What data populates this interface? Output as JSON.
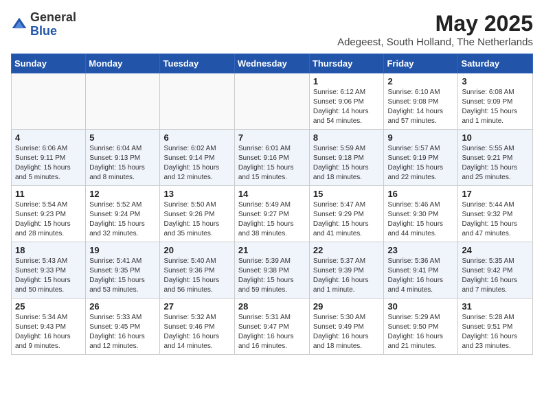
{
  "header": {
    "logo_general": "General",
    "logo_blue": "Blue",
    "month_year": "May 2025",
    "location": "Adegeest, South Holland, The Netherlands"
  },
  "weekdays": [
    "Sunday",
    "Monday",
    "Tuesday",
    "Wednesday",
    "Thursday",
    "Friday",
    "Saturday"
  ],
  "weeks": [
    [
      {
        "day": "",
        "info": ""
      },
      {
        "day": "",
        "info": ""
      },
      {
        "day": "",
        "info": ""
      },
      {
        "day": "",
        "info": ""
      },
      {
        "day": "1",
        "info": "Sunrise: 6:12 AM\nSunset: 9:06 PM\nDaylight: 14 hours\nand 54 minutes."
      },
      {
        "day": "2",
        "info": "Sunrise: 6:10 AM\nSunset: 9:08 PM\nDaylight: 14 hours\nand 57 minutes."
      },
      {
        "day": "3",
        "info": "Sunrise: 6:08 AM\nSunset: 9:09 PM\nDaylight: 15 hours\nand 1 minute."
      }
    ],
    [
      {
        "day": "4",
        "info": "Sunrise: 6:06 AM\nSunset: 9:11 PM\nDaylight: 15 hours\nand 5 minutes."
      },
      {
        "day": "5",
        "info": "Sunrise: 6:04 AM\nSunset: 9:13 PM\nDaylight: 15 hours\nand 8 minutes."
      },
      {
        "day": "6",
        "info": "Sunrise: 6:02 AM\nSunset: 9:14 PM\nDaylight: 15 hours\nand 12 minutes."
      },
      {
        "day": "7",
        "info": "Sunrise: 6:01 AM\nSunset: 9:16 PM\nDaylight: 15 hours\nand 15 minutes."
      },
      {
        "day": "8",
        "info": "Sunrise: 5:59 AM\nSunset: 9:18 PM\nDaylight: 15 hours\nand 18 minutes."
      },
      {
        "day": "9",
        "info": "Sunrise: 5:57 AM\nSunset: 9:19 PM\nDaylight: 15 hours\nand 22 minutes."
      },
      {
        "day": "10",
        "info": "Sunrise: 5:55 AM\nSunset: 9:21 PM\nDaylight: 15 hours\nand 25 minutes."
      }
    ],
    [
      {
        "day": "11",
        "info": "Sunrise: 5:54 AM\nSunset: 9:23 PM\nDaylight: 15 hours\nand 28 minutes."
      },
      {
        "day": "12",
        "info": "Sunrise: 5:52 AM\nSunset: 9:24 PM\nDaylight: 15 hours\nand 32 minutes."
      },
      {
        "day": "13",
        "info": "Sunrise: 5:50 AM\nSunset: 9:26 PM\nDaylight: 15 hours\nand 35 minutes."
      },
      {
        "day": "14",
        "info": "Sunrise: 5:49 AM\nSunset: 9:27 PM\nDaylight: 15 hours\nand 38 minutes."
      },
      {
        "day": "15",
        "info": "Sunrise: 5:47 AM\nSunset: 9:29 PM\nDaylight: 15 hours\nand 41 minutes."
      },
      {
        "day": "16",
        "info": "Sunrise: 5:46 AM\nSunset: 9:30 PM\nDaylight: 15 hours\nand 44 minutes."
      },
      {
        "day": "17",
        "info": "Sunrise: 5:44 AM\nSunset: 9:32 PM\nDaylight: 15 hours\nand 47 minutes."
      }
    ],
    [
      {
        "day": "18",
        "info": "Sunrise: 5:43 AM\nSunset: 9:33 PM\nDaylight: 15 hours\nand 50 minutes."
      },
      {
        "day": "19",
        "info": "Sunrise: 5:41 AM\nSunset: 9:35 PM\nDaylight: 15 hours\nand 53 minutes."
      },
      {
        "day": "20",
        "info": "Sunrise: 5:40 AM\nSunset: 9:36 PM\nDaylight: 15 hours\nand 56 minutes."
      },
      {
        "day": "21",
        "info": "Sunrise: 5:39 AM\nSunset: 9:38 PM\nDaylight: 15 hours\nand 59 minutes."
      },
      {
        "day": "22",
        "info": "Sunrise: 5:37 AM\nSunset: 9:39 PM\nDaylight: 16 hours\nand 1 minute."
      },
      {
        "day": "23",
        "info": "Sunrise: 5:36 AM\nSunset: 9:41 PM\nDaylight: 16 hours\nand 4 minutes."
      },
      {
        "day": "24",
        "info": "Sunrise: 5:35 AM\nSunset: 9:42 PM\nDaylight: 16 hours\nand 7 minutes."
      }
    ],
    [
      {
        "day": "25",
        "info": "Sunrise: 5:34 AM\nSunset: 9:43 PM\nDaylight: 16 hours\nand 9 minutes."
      },
      {
        "day": "26",
        "info": "Sunrise: 5:33 AM\nSunset: 9:45 PM\nDaylight: 16 hours\nand 12 minutes."
      },
      {
        "day": "27",
        "info": "Sunrise: 5:32 AM\nSunset: 9:46 PM\nDaylight: 16 hours\nand 14 minutes."
      },
      {
        "day": "28",
        "info": "Sunrise: 5:31 AM\nSunset: 9:47 PM\nDaylight: 16 hours\nand 16 minutes."
      },
      {
        "day": "29",
        "info": "Sunrise: 5:30 AM\nSunset: 9:49 PM\nDaylight: 16 hours\nand 18 minutes."
      },
      {
        "day": "30",
        "info": "Sunrise: 5:29 AM\nSunset: 9:50 PM\nDaylight: 16 hours\nand 21 minutes."
      },
      {
        "day": "31",
        "info": "Sunrise: 5:28 AM\nSunset: 9:51 PM\nDaylight: 16 hours\nand 23 minutes."
      }
    ]
  ]
}
